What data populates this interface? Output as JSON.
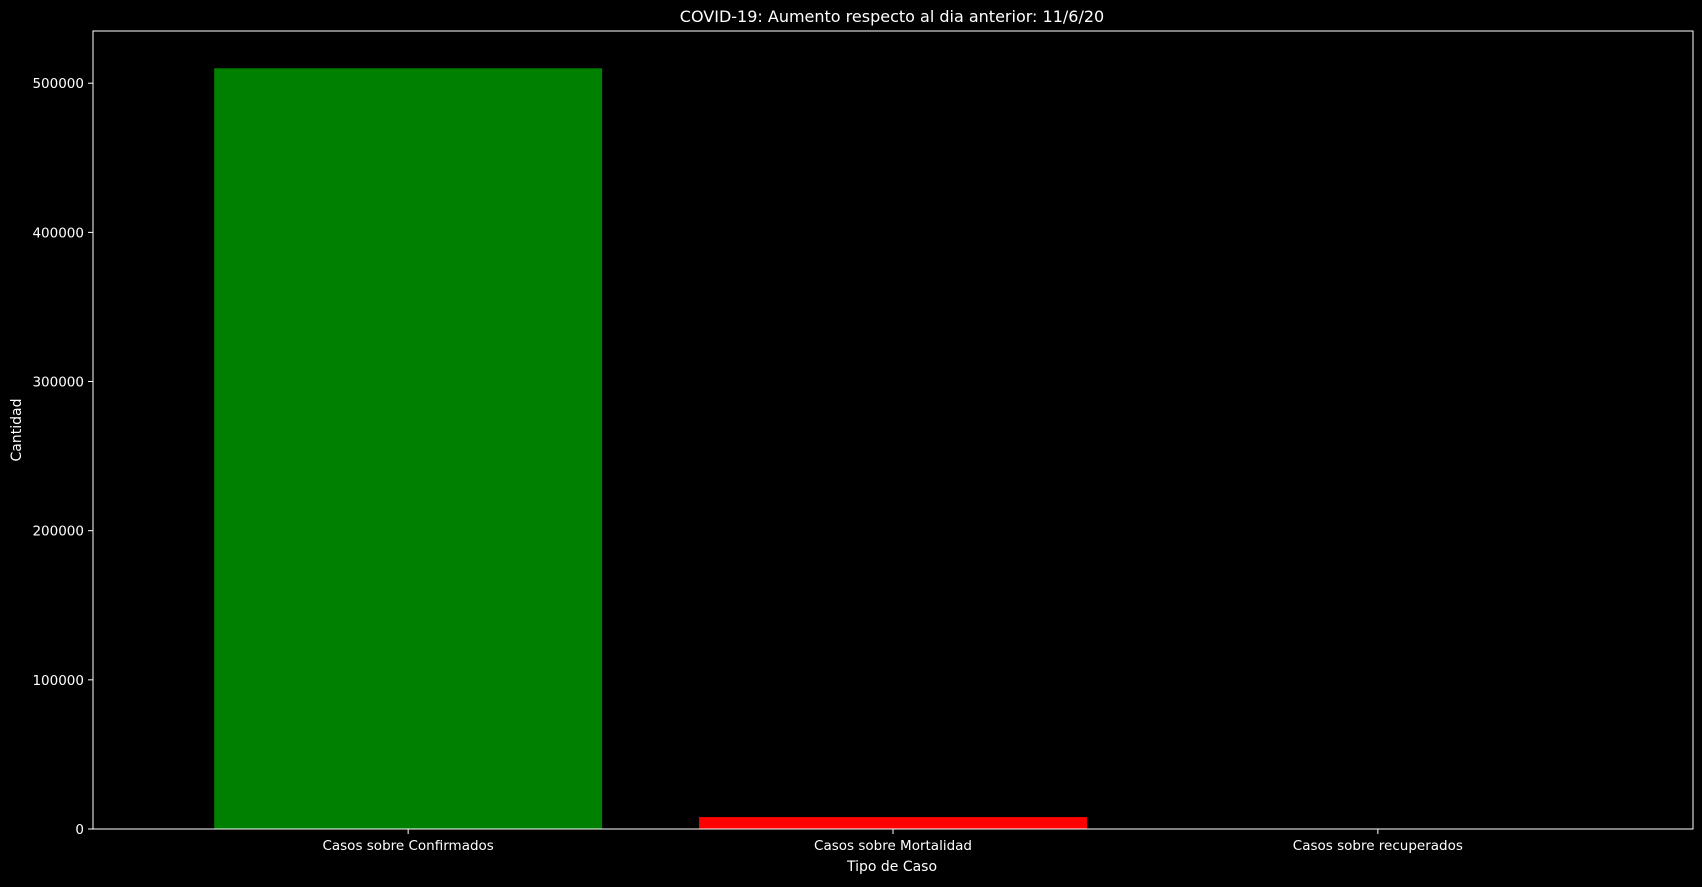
{
  "chart_data": {
    "type": "bar",
    "title": "COVID-19: Aumento respecto al dia anterior: 11/6/20",
    "xlabel": "Tipo de Caso",
    "ylabel": "Cantidad",
    "categories": [
      "Casos sobre Confirmados",
      "Casos sobre Mortalidad",
      "Casos sobre recuperados"
    ],
    "values": [
      510000,
      8000,
      0
    ],
    "colors": [
      "#008000",
      "#ff0000",
      "#0000ff"
    ],
    "ylim": [
      0,
      535000
    ],
    "yticks": [
      0,
      100000,
      200000,
      300000,
      400000,
      500000
    ],
    "ytick_labels": [
      "0",
      "100000",
      "200000",
      "300000",
      "400000",
      "500000"
    ],
    "grid": false,
    "legend": "none",
    "background": "#000000",
    "foreground": "#ffffff"
  }
}
